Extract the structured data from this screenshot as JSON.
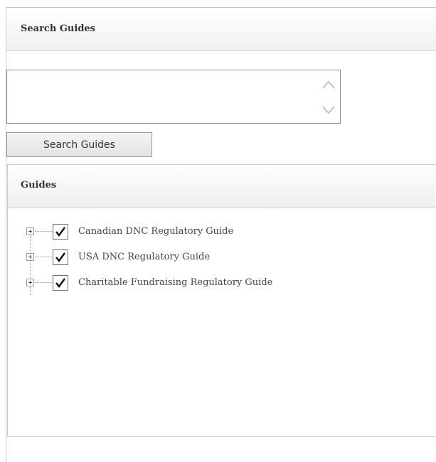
{
  "search_panel": {
    "title": "Search Guides",
    "search_input": {
      "value": "",
      "placeholder": ""
    },
    "search_button_label": "Search Guides"
  },
  "guides_panel": {
    "title": "Guides",
    "items": [
      {
        "label": "Canadian DNC Regulatory Guide",
        "checked": true,
        "expander_icon": "plus-box-icon"
      },
      {
        "label": "USA DNC Regulatory Guide",
        "checked": true,
        "expander_icon": "plus-box-icon"
      },
      {
        "label": "Charitable Fundraising Regulatory Guide",
        "checked": true,
        "expander_icon": "plus-box-icon"
      }
    ]
  },
  "icons": {
    "scroll_up": "chevron-up-icon",
    "scroll_down": "chevron-down-icon",
    "checkbox": "checkmark-icon"
  },
  "colors": {
    "panel_border": "#c9c9c9",
    "text": "#333333",
    "checkmark": "#111111"
  }
}
